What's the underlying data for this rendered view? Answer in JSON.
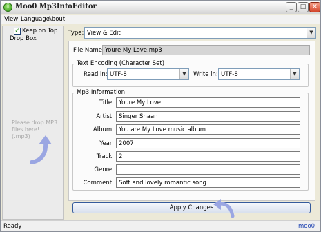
{
  "window": {
    "title": "Moo0 Mp3InfoEditor",
    "icon_letter": "i"
  },
  "menu": {
    "items": [
      "View",
      "Language",
      "About"
    ]
  },
  "sidebar": {
    "keep_on_top_label": "Keep on Top",
    "keep_on_top_checked": true,
    "drop_box_label": "Drop Box",
    "drop_hint": [
      "Please drop MP3",
      "files here!",
      "(.mp3)"
    ]
  },
  "type": {
    "label": "Type:",
    "value": "View & Edit"
  },
  "file": {
    "label": "File Name:",
    "value": "Youre My Love.mp3"
  },
  "encoding": {
    "group_title": "Text Encoding (Character Set)",
    "read_label": "Read in:",
    "read_value": "UTF-8",
    "write_label": "Write in:",
    "write_value": "UTF-8"
  },
  "mp3_info": {
    "group_title": "Mp3 Information",
    "fields": [
      {
        "label": "Title:",
        "value": "Youre My Love"
      },
      {
        "label": "Artist:",
        "value": "Singer Shaan"
      },
      {
        "label": "Album:",
        "value": "You are My Love music album"
      },
      {
        "label": "Year:",
        "value": "2007"
      },
      {
        "label": "Track:",
        "value": "2"
      },
      {
        "label": "Genre:",
        "value": ""
      },
      {
        "label": "Comment:",
        "value": "Soft and lovely romantic song"
      }
    ]
  },
  "apply_label": "Apply Changes",
  "status": {
    "text": "Ready",
    "link": "moo0"
  },
  "colors": {
    "accent_arrow": "#9aa6e2",
    "link": "#1a3fb0"
  }
}
